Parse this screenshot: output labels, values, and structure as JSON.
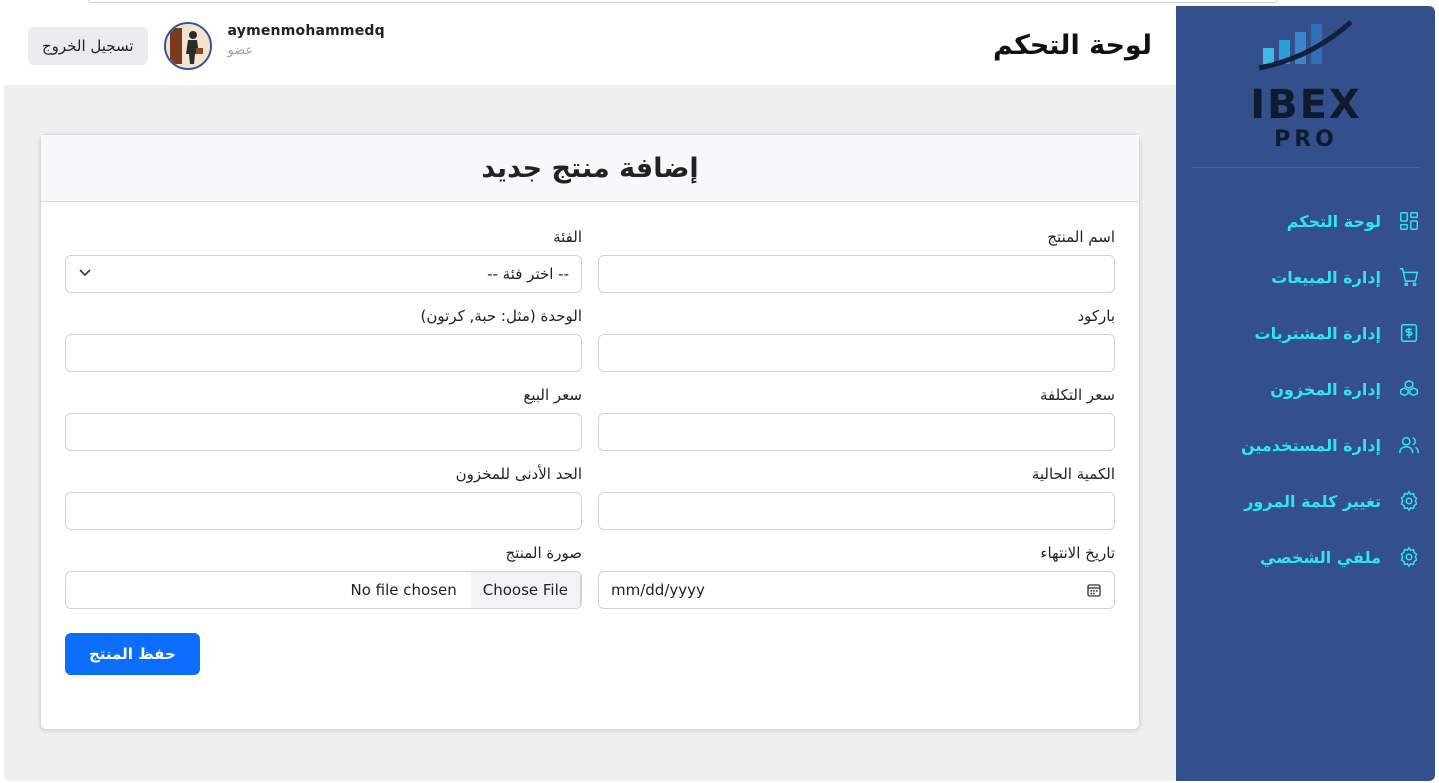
{
  "brand": {
    "logo_main": "IBEX",
    "logo_sub": "PRO"
  },
  "sidebar": {
    "items": [
      {
        "label": "لوحة التحكم",
        "icon": "dashboard-icon"
      },
      {
        "label": "إدارة المبيعات",
        "icon": "cart-icon"
      },
      {
        "label": "إدارة المشتريات",
        "icon": "dollar-doc-icon"
      },
      {
        "label": "إدارة المخزون",
        "icon": "boxes-icon"
      },
      {
        "label": "إدارة المستخدمين",
        "icon": "users-icon"
      },
      {
        "label": "تغيير كلمة المرور",
        "icon": "gear-icon"
      },
      {
        "label": "ملفي الشخصي",
        "icon": "gear-icon"
      }
    ]
  },
  "header": {
    "title": "لوحة التحكم",
    "username": "aymenmohammedq",
    "role": "عضو",
    "logout_label": "تسجيل الخروج"
  },
  "form": {
    "title": "إضافة منتج جديد",
    "fields": {
      "product_name": {
        "label": "اسم المنتج",
        "value": ""
      },
      "category": {
        "label": "الفئة",
        "value": "-- اختر فئة --"
      },
      "barcode": {
        "label": "باركود",
        "value": ""
      },
      "unit": {
        "label": "الوحدة (مثل: حبة, كرتون)",
        "value": ""
      },
      "cost_price": {
        "label": "سعر التكلفة",
        "value": ""
      },
      "sale_price": {
        "label": "سعر البيع",
        "value": ""
      },
      "current_qty": {
        "label": "الكمية الحالية",
        "value": ""
      },
      "min_stock": {
        "label": "الحد الأدنى للمخزون",
        "value": ""
      },
      "expiry_date": {
        "label": "تاريخ الانتهاء",
        "placeholder": "mm/dd/yyyy"
      },
      "product_image": {
        "label": "صورة المنتج",
        "button": "Choose File",
        "status": "No file chosen"
      }
    },
    "save_label": "حفظ المنتج"
  },
  "colors": {
    "sidebar_bg": "#334f8c",
    "nav_text": "#2ee6f2",
    "primary": "#0d6efd"
  }
}
